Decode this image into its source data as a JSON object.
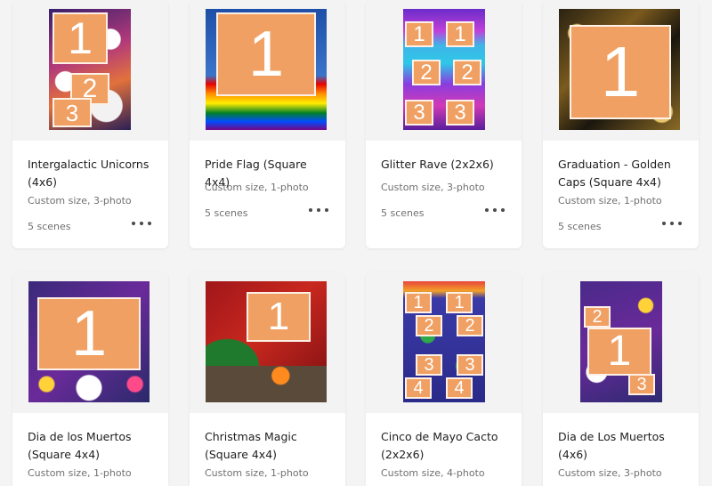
{
  "colors": {
    "accent": "#f0a062",
    "card_bg": "#ffffff",
    "thumb_bg": "#f3f3f4",
    "page_bg": "#f4f4f5"
  },
  "icons": {
    "more": "more-options-icon"
  },
  "templates": [
    {
      "title": "Intergalactic Unicorns (4x6)",
      "meta": "Custom size, 3-photo",
      "scenes": "5 scenes",
      "slots": [
        "1",
        "2",
        "3"
      ]
    },
    {
      "title": "Pride Flag (Square 4x4)",
      "meta": "Custom size, 1-photo",
      "scenes": "5 scenes",
      "slots": [
        "1"
      ]
    },
    {
      "title": "Glitter Rave (2x2x6)",
      "meta": "Custom size, 3-photo",
      "scenes": "5 scenes",
      "slots": [
        "1",
        "1",
        "2",
        "2",
        "3",
        "3"
      ]
    },
    {
      "title": "Graduation - Golden Caps (Square 4x4)",
      "meta": "Custom size, 1-photo",
      "scenes": "5 scenes",
      "slots": [
        "1"
      ]
    },
    {
      "title": "Dia de los Muertos (Square 4x4)",
      "meta": "Custom size, 1-photo",
      "scenes": "",
      "slots": [
        "1"
      ]
    },
    {
      "title": "Christmas Magic (Square 4x4)",
      "meta": "Custom size, 1-photo",
      "scenes": "",
      "slots": [
        "1"
      ]
    },
    {
      "title": "Cinco de Mayo Cacto (2x2x6)",
      "meta": "Custom size, 4-photo",
      "scenes": "",
      "slots": [
        "1",
        "1",
        "2",
        "2",
        "3",
        "3",
        "4",
        "4"
      ]
    },
    {
      "title": "Dia de Los Muertos (4x6)",
      "meta": "Custom size, 3-photo",
      "scenes": "",
      "slots": [
        "2",
        "1",
        "3"
      ]
    }
  ]
}
